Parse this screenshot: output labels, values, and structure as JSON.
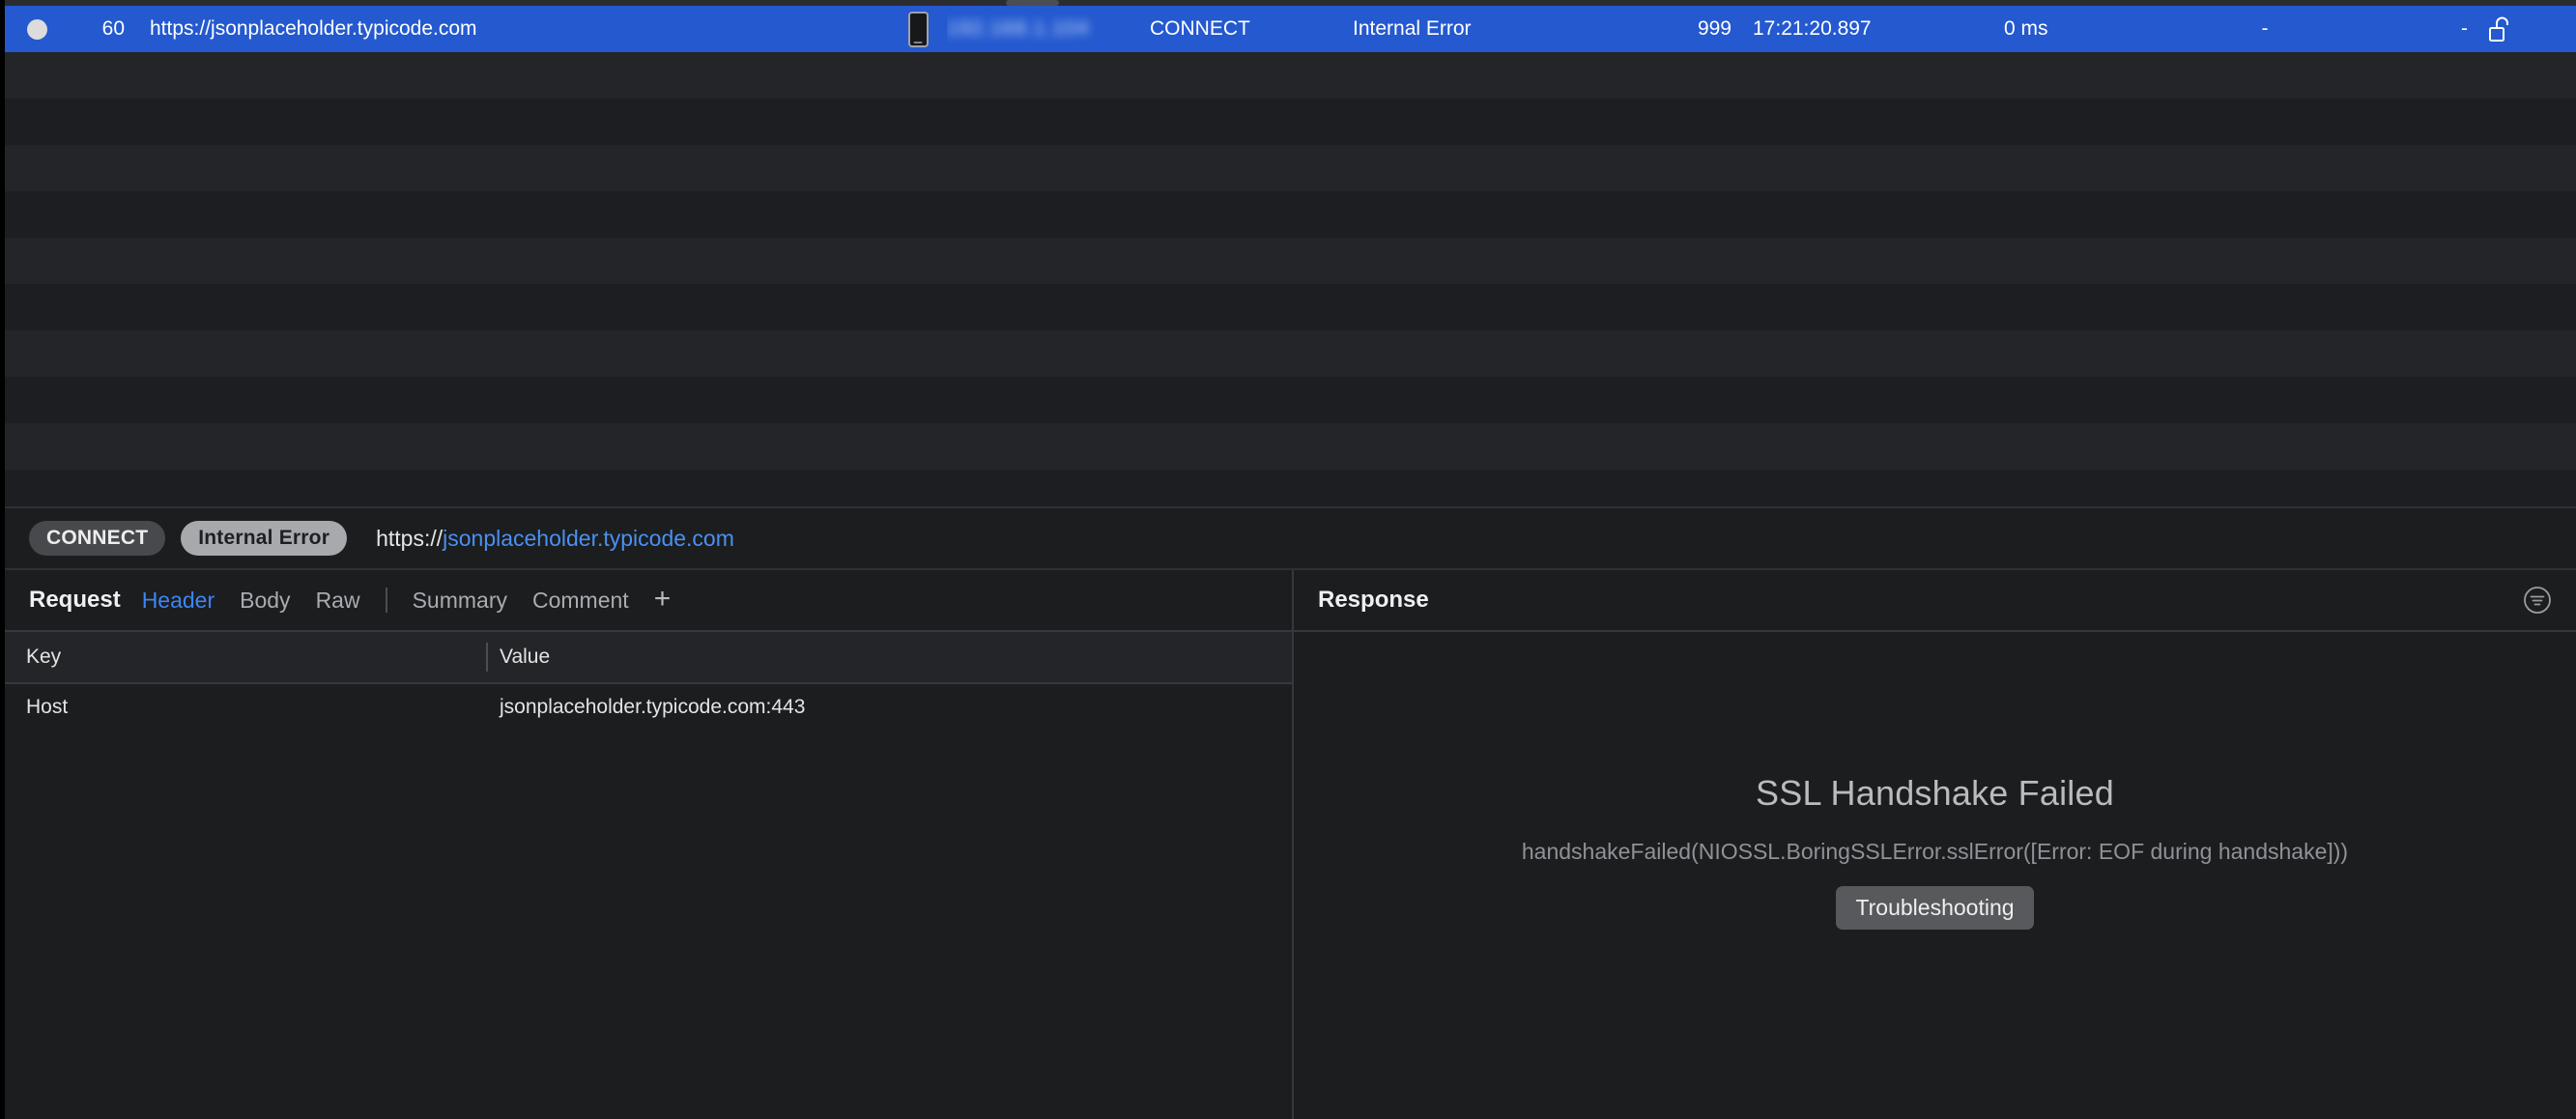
{
  "request_list": {
    "columns": [
      "dot",
      "num",
      "url",
      "device",
      "ip",
      "method",
      "status",
      "size",
      "time",
      "duration",
      "d1",
      "d2",
      "lock"
    ],
    "selected_row": {
      "status_dot": "filled-circle",
      "num": "60",
      "url": "https://jsonplaceholder.typicode.com",
      "device_icon": "phone-icon",
      "ip": "192.168.1.104",
      "method": "CONNECT",
      "status": "Internal Error",
      "size": "999",
      "time": "17:21:20.897",
      "duration": "0 ms",
      "col_d1": "-",
      "col_d2": "-",
      "lock_icon": "unlocked-icon"
    },
    "empty_rows": 10
  },
  "breadcrumb": {
    "method_pill": "CONNECT",
    "status_pill": "Internal Error",
    "url_scheme": "https://",
    "url_host": "jsonplaceholder.typicode.com"
  },
  "request_pane": {
    "title": "Request",
    "tabs": [
      {
        "label": "Header",
        "active": true
      },
      {
        "label": "Body",
        "active": false
      },
      {
        "label": "Raw",
        "active": false
      }
    ],
    "tabs_secondary": [
      {
        "label": "Summary",
        "active": false
      },
      {
        "label": "Comment",
        "active": false
      }
    ],
    "add_tab_label": "+",
    "table": {
      "headers": [
        "Key",
        "Value"
      ],
      "rows": [
        {
          "key": "Host",
          "value": "jsonplaceholder.typicode.com:443"
        }
      ]
    }
  },
  "response_pane": {
    "title": "Response",
    "filter_icon": "filter-lines-circle-icon",
    "empty_state": {
      "title": "SSL Handshake Failed",
      "detail": "handshakeFailed(NIOSSL.BoringSSLError.sslError([Error:  EOF during handshake]))",
      "button": "Troubleshooting"
    }
  },
  "colors": {
    "selection_blue": "#2459cf",
    "link_blue": "#4a90f0",
    "tab_active_blue": "#3d86f5",
    "row_alt_a": "#232528",
    "row_alt_b": "#1c1e21",
    "background": "#1b1d1f"
  }
}
